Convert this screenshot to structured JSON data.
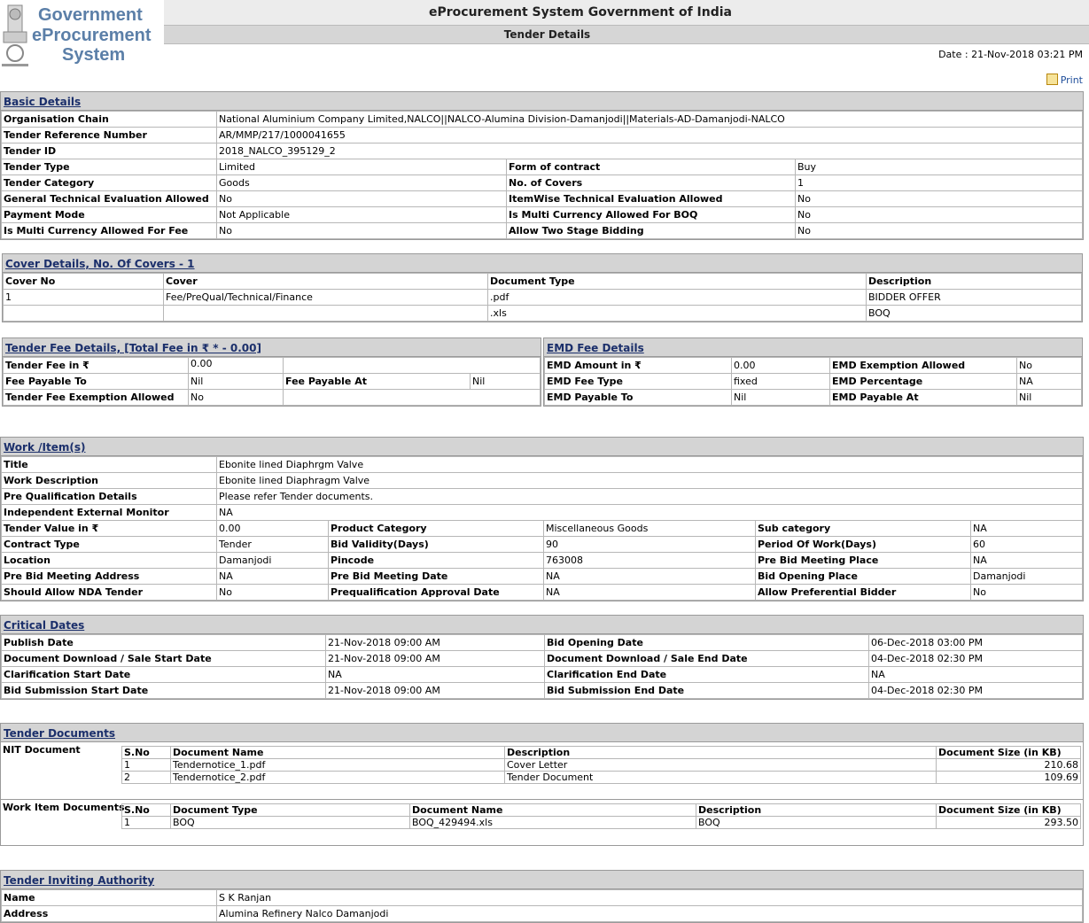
{
  "header": {
    "app_title": "eProcurement System Government of India",
    "page_title": "Tender Details",
    "logo_lines": [
      "Government",
      "eProcurement",
      "System"
    ],
    "date": "Date : 21-Nov-2018 03:21 PM",
    "print_label": "Print"
  },
  "basic": {
    "title": "Basic Details",
    "org_chain_label": "Organisation Chain",
    "org_chain": "National Aluminium Company Limited,NALCO||NALCO-Alumina Division-Damanjodi||Materials-AD-Damanjodi-NALCO",
    "ref_label": "Tender Reference Number",
    "ref": "AR/MMP/217/1000041655",
    "id_label": "Tender ID",
    "id": "2018_NALCO_395129_2",
    "rows": [
      [
        "Tender Type",
        "Limited",
        "Form of contract",
        "Buy"
      ],
      [
        "Tender Category",
        "Goods",
        "No. of Covers",
        "1"
      ],
      [
        "General Technical Evaluation Allowed",
        "No",
        "ItemWise Technical Evaluation Allowed",
        "No"
      ],
      [
        "Payment Mode",
        "Not Applicable",
        "Is Multi Currency Allowed For BOQ",
        "No"
      ],
      [
        "Is Multi Currency Allowed For Fee",
        "No",
        "Allow Two Stage Bidding",
        "No"
      ]
    ]
  },
  "cover": {
    "title": "Cover Details, No. Of Covers - 1",
    "headers": [
      "Cover No",
      "Cover",
      "Document Type",
      "Description"
    ],
    "rows": [
      [
        "1",
        "Fee/PreQual/Technical/Finance",
        ".pdf",
        "BIDDER OFFER"
      ],
      [
        "",
        "",
        ".xls",
        "BOQ"
      ]
    ]
  },
  "fee": {
    "title": "Tender Fee Details, [Total Fee in ₹ * - 0.00]",
    "fee_label": "Tender Fee in ₹",
    "fee": "0.00",
    "payable_to_label": "Fee Payable To",
    "payable_to": "Nil",
    "payable_at_label": "Fee Payable At",
    "payable_at": "Nil",
    "exemption_label": "Tender Fee Exemption Allowed",
    "exemption": "No"
  },
  "emd": {
    "title": "EMD Fee Details",
    "rows": [
      [
        "EMD Amount in ₹",
        "0.00",
        "EMD Exemption Allowed",
        "No"
      ],
      [
        "EMD Fee Type",
        "fixed",
        "EMD Percentage",
        "NA"
      ],
      [
        "EMD Payable To",
        "Nil",
        "EMD Payable At",
        "Nil"
      ]
    ]
  },
  "work": {
    "title": "Work /Item(s)",
    "single": [
      [
        "Title",
        "Ebonite lined Diaphrgm Valve"
      ],
      [
        "Work Description",
        "Ebonite lined Diaphragm Valve"
      ],
      [
        "Pre Qualification Details",
        "Please refer Tender documents."
      ],
      [
        "Independent External Monitor",
        "NA"
      ]
    ],
    "rows": [
      [
        "Tender Value in ₹",
        "0.00",
        "Product Category",
        "Miscellaneous Goods",
        "Sub category",
        "NA"
      ],
      [
        "Contract Type",
        "Tender",
        "Bid Validity(Days)",
        "90",
        "Period Of Work(Days)",
        "60"
      ],
      [
        "Location",
        "Damanjodi",
        "Pincode",
        "763008",
        "Pre Bid Meeting Place",
        "NA"
      ],
      [
        "Pre Bid Meeting Address",
        "NA",
        "Pre Bid Meeting Date",
        "NA",
        "Bid Opening Place",
        "Damanjodi"
      ],
      [
        "Should Allow NDA Tender",
        "No",
        "Prequalification Approval Date",
        "NA",
        "Allow Preferential Bidder",
        "No"
      ]
    ]
  },
  "dates": {
    "title": "Critical Dates",
    "rows": [
      [
        "Publish Date",
        "21-Nov-2018 09:00 AM",
        "Bid Opening Date",
        "06-Dec-2018 03:00 PM"
      ],
      [
        "Document Download / Sale Start Date",
        "21-Nov-2018 09:00 AM",
        "Document Download / Sale End Date",
        "04-Dec-2018 02:30 PM"
      ],
      [
        "Clarification Start Date",
        "NA",
        "Clarification End Date",
        "NA"
      ],
      [
        "Bid Submission Start Date",
        "21-Nov-2018 09:00 AM",
        "Bid Submission End Date",
        "04-Dec-2018 02:30 PM"
      ]
    ]
  },
  "docs": {
    "title": "Tender Documents",
    "nit_label": "NIT Document",
    "nit_headers": [
      "S.No",
      "Document Name",
      "Description",
      "Document Size (in KB)"
    ],
    "nit_rows": [
      [
        "1",
        "Tendernotice_1.pdf",
        "Cover Letter",
        "210.68"
      ],
      [
        "2",
        "Tendernotice_2.pdf",
        "Tender Document",
        "109.69"
      ]
    ],
    "work_label": "Work Item Documents",
    "work_headers": [
      "S.No",
      "Document Type",
      "Document Name",
      "Description",
      "Document Size (in KB)"
    ],
    "work_rows": [
      [
        "1",
        "BOQ",
        "BOQ_429494.xls",
        "BOQ",
        "293.50"
      ]
    ]
  },
  "authority": {
    "title": "Tender Inviting Authority",
    "rows": [
      [
        "Name",
        "S K Ranjan"
      ],
      [
        "Address",
        "Alumina Refinery Nalco Damanjodi"
      ]
    ]
  }
}
